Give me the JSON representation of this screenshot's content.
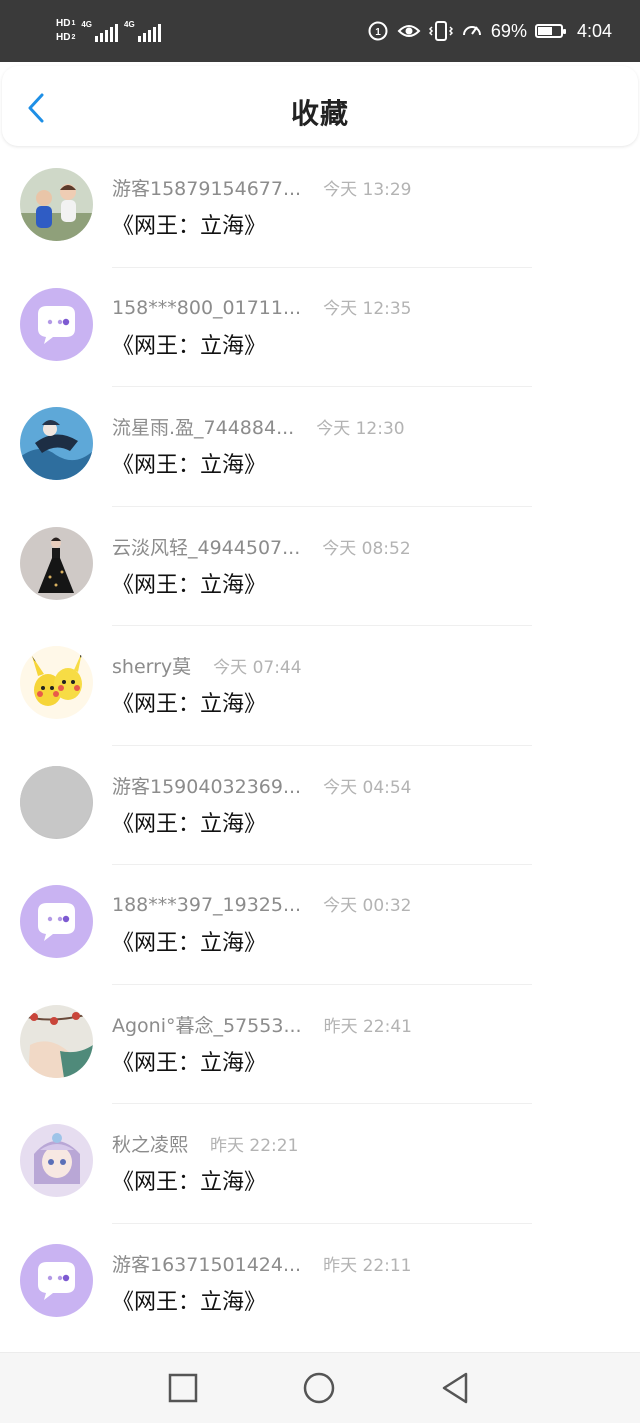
{
  "status_bar": {
    "hd1": "HD",
    "hd1_sub": "1",
    "hd2": "HD",
    "hd2_sub": "2",
    "net1": "4G",
    "net2": "4G",
    "battery_percent": "69%",
    "battery_level": 0.69,
    "time": "4:04",
    "icons": [
      "signal-icon",
      "eye-icon",
      "vibrate-icon",
      "speed-icon",
      "battery-icon"
    ]
  },
  "header": {
    "back_icon": "chevron-left-icon",
    "title": "收藏",
    "accent_color": "#1e8fe6"
  },
  "favorites": [
    {
      "name": "游客15879154677...",
      "time": "今天 13:29",
      "book": "《网王：立海》",
      "avatar": "photo-kids"
    },
    {
      "name": "158***800_01711...",
      "time": "今天 12:35",
      "book": "《网王：立海》",
      "avatar": "default-chat"
    },
    {
      "name": "流星雨.盈_744884...",
      "time": "今天 12:30",
      "book": "《网王：立海》",
      "avatar": "photo-anime-blue"
    },
    {
      "name": "云淡风轻_4944507...",
      "time": "今天 08:52",
      "book": "《网王：立海》",
      "avatar": "photo-dress"
    },
    {
      "name": "sherry莫",
      "time": "今天 07:44",
      "book": "《网王：立海》",
      "avatar": "photo-pikachu"
    },
    {
      "name": "游客15904032369...",
      "time": "今天 04:54",
      "book": "《网王：立海》",
      "avatar": "photo-grey"
    },
    {
      "name": "188***397_19325...",
      "time": "今天 00:32",
      "book": "《网王：立海》",
      "avatar": "default-chat"
    },
    {
      "name": "Agoni°暮念_57553...",
      "time": "昨天 22:41",
      "book": "《网王：立海》",
      "avatar": "photo-flowers"
    },
    {
      "name": "秋之凌熙",
      "time": "昨天 22:21",
      "book": "《网王：立海》",
      "avatar": "photo-anime-girl"
    },
    {
      "name": "游客16371501424...",
      "time": "昨天 22:11",
      "book": "《网王：立海》",
      "avatar": "default-chat"
    }
  ],
  "nav_bar": {
    "recents": "square-icon",
    "home": "circle-icon",
    "back": "triangle-back-icon"
  }
}
